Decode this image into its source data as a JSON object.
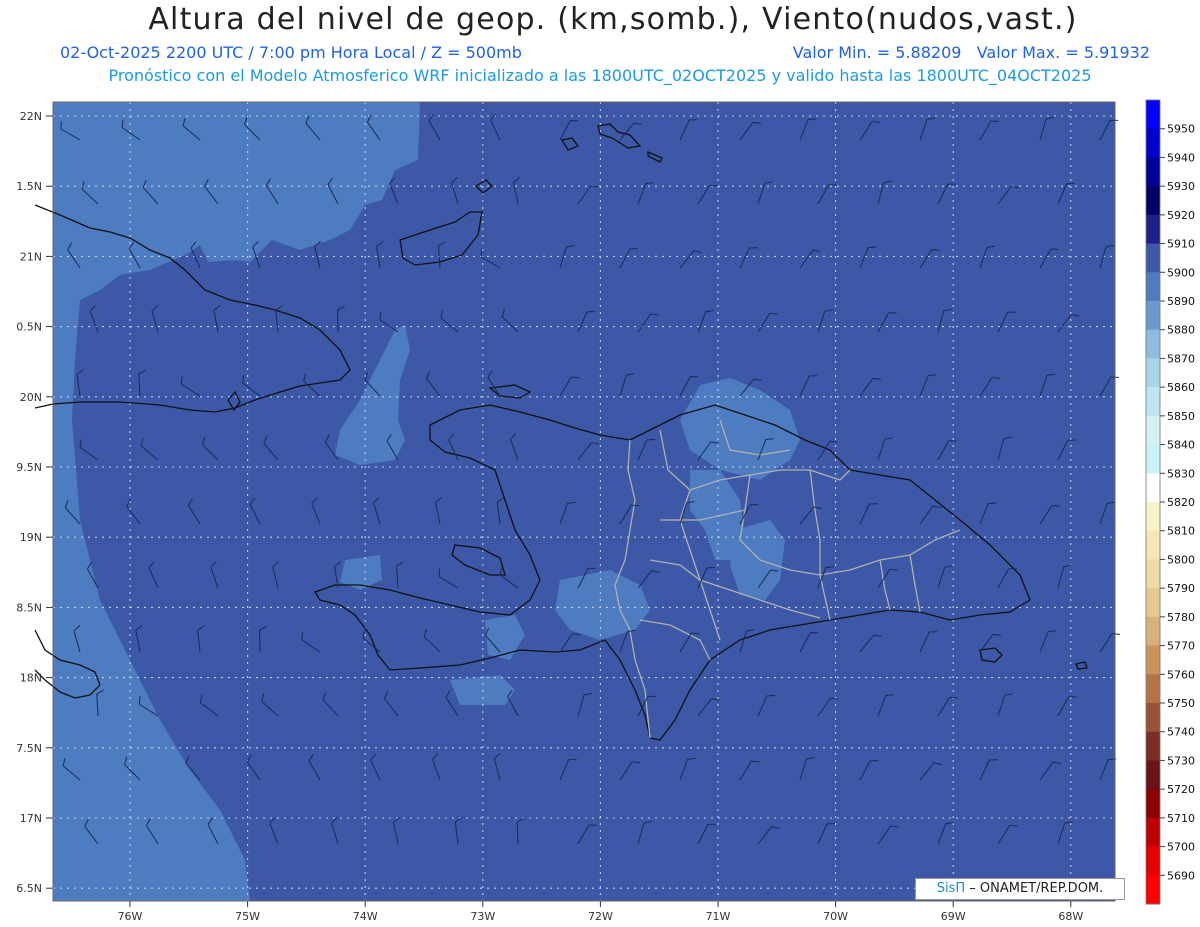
{
  "header": {
    "title": "Altura del nivel de geop. (km,somb.), Viento(nudos,vast.)",
    "datetime": "02-Oct-2025  2200 UTC / 7:00 pm Hora Local / Z = 500mb",
    "min_value": "Valor Min. = 5.88209",
    "max_value": "Valor Max. = 5.91932",
    "model_info": "Pronóstico con el Modelo Atmosferico WRF inicializado a las 1800UTC_02OCT2025 y valido hasta las  1800UTC_04OCT2025"
  },
  "map": {
    "lat_labels": [
      "22N",
      "1.5N",
      "21N",
      "0.5N",
      "20N",
      "9.5N",
      "19N",
      "8.5N",
      "18N",
      "7.5N",
      "17N",
      "6.5N"
    ],
    "lon_labels": [
      "76W",
      "75W",
      "74W",
      "73W",
      "72W",
      "71W",
      "70W",
      "69W",
      "68W"
    ],
    "colors": {
      "ocean_main": "#3c58a6",
      "light_band": "#4d7cc0",
      "coast": "#111111",
      "borders": "#b0b0b0",
      "grid": "#c8d0e8",
      "barbs": "#1c2a55"
    }
  },
  "colorbar": {
    "levels": [
      "5950",
      "5940",
      "5930",
      "5920",
      "5910",
      "5900",
      "5890",
      "5880",
      "5870",
      "5860",
      "5850",
      "5840",
      "5830",
      "5820",
      "5810",
      "5800",
      "5790",
      "5780",
      "5770",
      "5760",
      "5750",
      "5740",
      "5730",
      "5720",
      "5710",
      "5700",
      "5690"
    ],
    "colors": [
      "#0000ff",
      "#0000cc",
      "#000099",
      "#000066",
      "#20208a",
      "#3c58a6",
      "#4d7cc0",
      "#6a9bd0",
      "#8ebce0",
      "#a7d6ea",
      "#bfe6f0",
      "#d5f1f6",
      "#c8f2f6",
      "#ffffff",
      "#fbf3c8",
      "#f5e6b4",
      "#efd9a4",
      "#e6c890",
      "#d8b07a",
      "#c8945c",
      "#b57446",
      "#9c5236",
      "#7e2c26",
      "#6c1218",
      "#8c0000",
      "#c00000",
      "#e60000",
      "#ff0000"
    ]
  },
  "credit": {
    "brand": "SisΠ",
    "text": " – ONAMET/REP.DOM."
  }
}
